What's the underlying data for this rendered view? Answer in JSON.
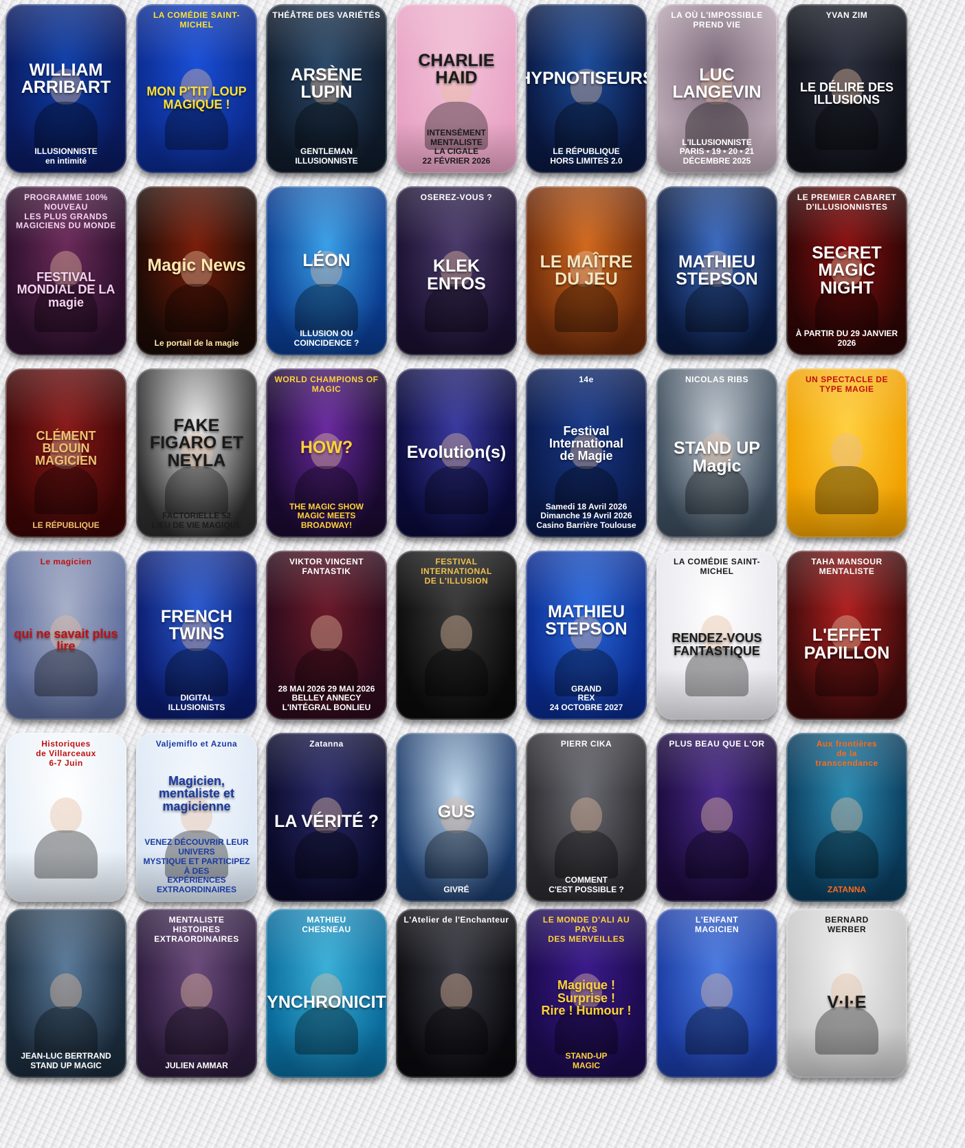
{
  "cards": [
    {
      "top": "",
      "title": "WILLIAM\nARRIBART",
      "bottom": "ILLUSIONNISTE\nen intimité",
      "bg": "#0a1a5e",
      "bg2": "#0f3fa8",
      "fg": "#ffffff"
    },
    {
      "top": "LA COMÉDIE SAINT-MICHEL",
      "title": "MON P'TIT LOUP\nMAGIQUE !",
      "bottom": "",
      "bg": "#0b2a8c",
      "bg2": "#1a4fd6",
      "fg": "#ffe033"
    },
    {
      "top": "THÉÂTRE DES VARIÉTÉS",
      "title": "ARSÈNE\nLUPIN",
      "bottom": "GENTLEMAN ILLUSIONNISTE",
      "bg": "#0f1a2a",
      "bg2": "#2c4a6a",
      "fg": "#ffffff"
    },
    {
      "top": "",
      "title": "CHARLIE HAID",
      "bottom": "INTENSÉMENT MENTALISTE\nLA CIGALE\n22 FÉVRIER 2026",
      "bg": "#e8a3c4",
      "bg2": "#f2c2d8",
      "fg": "#1a1a1a"
    },
    {
      "top": "",
      "title": "HYPNOTISEURS",
      "bottom": "LE RÉPUBLIQUE\nHORS LIMITES 2.0",
      "bg": "#0a1840",
      "bg2": "#1d4d9c",
      "fg": "#ffffff"
    },
    {
      "top": "LA OÙ L'IMPOSSIBLE PREND VIE",
      "title": "LUC LANGEVIN",
      "bottom": "L'ILLUSIONNISTE\nPARIS • 19 • 20 • 21 DÉCEMBRE 2025",
      "bg": "#b9a6b3",
      "bg2": "#7c6a7a",
      "fg": "#ffffff"
    },
    {
      "top": "YVAN ZIM",
      "title": "LE DÉLIRE DES ILLUSIONS",
      "bottom": "",
      "bg": "#10121a",
      "bg2": "#2b2f3d",
      "fg": "#ffffff"
    },
    {
      "top": "PROGRAMME 100% NOUVEAU\nLES PLUS GRANDS MAGICIENS DU MONDE",
      "title": "FESTIVAL\nMONDIAL DE LA\nmagie",
      "bottom": "",
      "bg": "#2a0f2a",
      "bg2": "#6b2a5a",
      "fg": "#f3d4f0"
    },
    {
      "top": "",
      "title": "Magic News",
      "bottom": "Le portail de la magie",
      "bg": "#1a0a05",
      "bg2": "#7a1e0a",
      "fg": "#ffe9b0"
    },
    {
      "top": "",
      "title": "LÉON",
      "bottom": "ILLUSION OU COINCIDENCE ?",
      "bg": "#0a3a8c",
      "bg2": "#3aa0e8",
      "fg": "#ffffff"
    },
    {
      "top": "OSEREZ-VOUS ?",
      "title": "KLEK\nENTOS",
      "bottom": "",
      "bg": "#1a1030",
      "bg2": "#4a3a6a",
      "fg": "#ffffff"
    },
    {
      "top": "",
      "title": "LE MAÎTRE\nDU JEU",
      "bottom": "",
      "bg": "#6a2a0a",
      "bg2": "#d2691e",
      "fg": "#f5e6c0"
    },
    {
      "top": "",
      "title": "MATHIEU\nSTEPSON",
      "bottom": "",
      "bg": "#0a1a40",
      "bg2": "#3a6ac0",
      "fg": "#ffffff"
    },
    {
      "top": "LE PREMIER CABARET D'ILLUSIONNISTES",
      "title": "SECRET\nMAGIC\nNIGHT",
      "bottom": "À PARTIR DU 29 JANVIER 2026",
      "bg": "#2a0505",
      "bg2": "#8a1010",
      "fg": "#ffffff"
    },
    {
      "top": "",
      "title": "CLÉMENT BLOUIN\nMAGICIEN",
      "bottom": "LE RÉPUBLIQUE",
      "bg": "#3a0505",
      "bg2": "#8a1a1a",
      "fg": "#f0c070"
    },
    {
      "top": "",
      "title": "FAKE\nFIGARO ET NEYLA",
      "bottom": "FACTORIELLE 52\nLIEU DE VIE MAGIQUE",
      "bg": "#2a2a2a",
      "bg2": "#f0f0f0",
      "fg": "#1a1a1a"
    },
    {
      "top": "WORLD CHAMPIONS OF MAGIC",
      "title": "HOW?",
      "bottom": "THE MAGIC SHOW\nMAGIC MEETS BROADWAY!",
      "bg": "#1a0a30",
      "bg2": "#6a2aa0",
      "fg": "#ffd23a"
    },
    {
      "top": "",
      "title": "Evolution(s)",
      "bottom": "",
      "bg": "#0a0a3a",
      "bg2": "#3a3aa0",
      "fg": "#ffffff"
    },
    {
      "top": "14e",
      "title": "Festival\nInternational\nde Magie",
      "bottom": "Samedi 18 Avril 2026\nDimanche 19 Avril 2026\nCasino Barrière Toulouse",
      "bg": "#0a1a4a",
      "bg2": "#1a3a8a",
      "fg": "#ffffff"
    },
    {
      "top": "NICOLAS RIBS",
      "title": "STAND UP\nMagic",
      "bottom": "",
      "bg": "#3a4a5a",
      "bg2": "#c0c8d0",
      "fg": "#ffffff"
    },
    {
      "top": "UN SPECTACLE DE\nTYPE MAGIE",
      "title": "",
      "bottom": "",
      "bg": "#f0a000",
      "bg2": "#ffd040",
      "fg": "#c01010"
    },
    {
      "top": "Le magicien",
      "title": "qui ne savait plus lire",
      "bottom": "",
      "bg": "#5a6a9a",
      "bg2": "#a8b0c8",
      "fg": "#c01010"
    },
    {
      "top": "",
      "title": "FRENCH TWINS",
      "bottom": "DIGITAL\nILLUSIONISTS",
      "bg": "#0a1a6a",
      "bg2": "#2a5ad0",
      "fg": "#ffffff"
    },
    {
      "top": "VIKTOR VINCENT\nFANTASTIK",
      "title": "",
      "bottom": "28 MAI 2026   29 MAI 2026\nBELLEY   ANNECY\nL'INTÉGRAL   BONLIEU",
      "bg": "#2a0a1a",
      "bg2": "#6a1a2a",
      "fg": "#ffffff"
    },
    {
      "top": "FESTIVAL INTERNATIONAL\nDE L'ILLUSION",
      "title": "",
      "bottom": "",
      "bg": "#0a0a0a",
      "bg2": "#3a3a3a",
      "fg": "#f0c050"
    },
    {
      "top": "",
      "title": "MATHIEU STEPSON",
      "bottom": "GRAND\nREX\n24 OCTOBRE 2027",
      "bg": "#0a2a8a",
      "bg2": "#2a6ae0",
      "fg": "#ffffff"
    },
    {
      "top": "LA COMÉDIE SAINT-MICHEL",
      "title": "RENDEZ-VOUS\nFANTASTIQUE",
      "bottom": "",
      "bg": "#e8e8ee",
      "bg2": "#ffffff",
      "fg": "#1a1a1a"
    },
    {
      "top": "TAHA MANSOUR\nMENTALISTE",
      "title": "L'EFFET\nPAPILLON",
      "bottom": "",
      "bg": "#3a0a0a",
      "bg2": "#b02020",
      "fg": "#ffffff"
    },
    {
      "top": "Historiques\nde Villarceaux\n6-7 Juin",
      "title": "",
      "bottom": "",
      "bg": "#e8f0f8",
      "bg2": "#ffffff",
      "fg": "#c01010"
    },
    {
      "top": "Valjemiflo et Azuna",
      "title": "Magicien,\nmentaliste et\nmagicienne",
      "bottom": "VENEZ DÉCOUVRIR LEUR UNIVERS\nMYSTIQUE ET PARTICIPEZ À DES\nEXPÉRIENCES EXTRAORDINAIRES",
      "bg": "#dde8f5",
      "bg2": "#f4f8fd",
      "fg": "#1a3aa0"
    },
    {
      "top": "Zatanna",
      "title": "LA VÉRITÉ ?",
      "bottom": "",
      "bg": "#0a0a2a",
      "bg2": "#2a2a6a",
      "fg": "#ffffff"
    },
    {
      "top": "",
      "title": "GUS",
      "bottom": "GIVRÉ",
      "bg": "#1a3a6a",
      "bg2": "#c0d8ec",
      "fg": "#ffffff"
    },
    {
      "top": "PIERR CIKA",
      "title": "",
      "bottom": "COMMENT\nC'EST POSSIBLE ?",
      "bg": "#2a2a2e",
      "bg2": "#6a6a72",
      "fg": "#ffffff"
    },
    {
      "top": "PLUS BEAU QUE L'OR",
      "title": "",
      "bottom": "",
      "bg": "#1a0a3a",
      "bg2": "#4a2a8a",
      "fg": "#ffffff"
    },
    {
      "top": "Aux frontières\nde la\ntranscendance",
      "title": "",
      "bottom": "ZATANNA",
      "bg": "#0a3a5a",
      "bg2": "#2a8ab0",
      "fg": "#ff6a1a"
    },
    {
      "top": "",
      "title": "",
      "bottom": "JEAN-LUC BERTRAND\nSTAND UP MAGIC",
      "bg": "#1a2a3a",
      "bg2": "#5a7a9a",
      "fg": "#ffffff"
    },
    {
      "top": "MENTALISTE\nHISTOIRES EXTRAORDINAIRES",
      "title": "",
      "bottom": "JULIEN AMMAR",
      "bg": "#2a1a3a",
      "bg2": "#6a4a7a",
      "fg": "#ffffff"
    },
    {
      "top": "MATHIEU\nCHESNEAU",
      "title": "SYNCHRONICITÉ",
      "bottom": "",
      "bg": "#0a6a9a",
      "bg2": "#3ab0d8",
      "fg": "#ffffff"
    },
    {
      "top": "L'Atelier de l'Enchanteur",
      "title": "",
      "bottom": "",
      "bg": "#0a0a0e",
      "bg2": "#3a3a44",
      "fg": "#ffffff"
    },
    {
      "top": "LE MONDE D'ALI AU PAYS\nDES MERVEILLES",
      "title": "Magique !  Surprise !\nRire !  Humour !",
      "bottom": "STAND-UP\nMAGIC",
      "bg": "#1a0a4a",
      "bg2": "#3a1a8a",
      "fg": "#ffd23a"
    },
    {
      "top": "L'ENFANT\nMAGICIEN",
      "title": "",
      "bottom": "",
      "bg": "#1a3aa0",
      "bg2": "#4a7ae0",
      "fg": "#ffffff"
    },
    {
      "top": "BERNARD\nWERBER",
      "title": "V·I·E",
      "bottom": "",
      "bg": "#c8c8c8",
      "bg2": "#f0f0f0",
      "fg": "#1a1a1a"
    }
  ]
}
